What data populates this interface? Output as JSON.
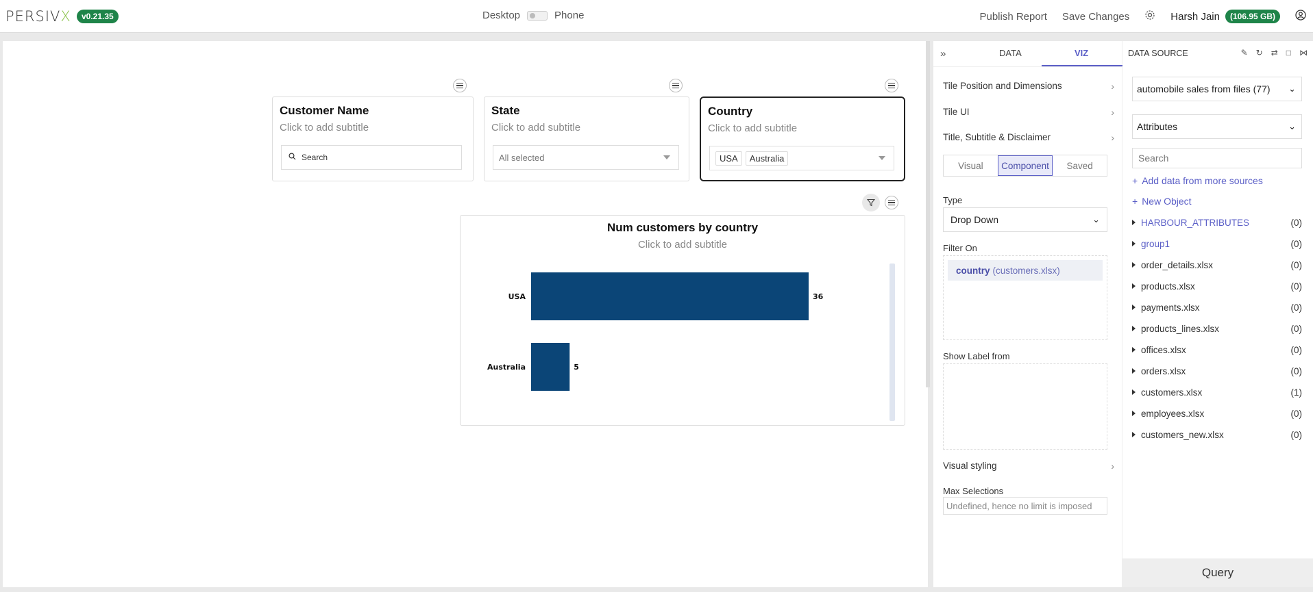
{
  "app": {
    "logo_main": "PERSIV",
    "logo_x": "X",
    "version": "v0.21.35"
  },
  "device": {
    "desktop": "Desktop",
    "phone": "Phone"
  },
  "header": {
    "publish": "Publish Report",
    "save": "Save Changes",
    "user": "Harsh Jain",
    "storage": "(106.95 GB)"
  },
  "tiles": {
    "customer_name": {
      "title": "Customer Name",
      "subtitle": "Click to add subtitle",
      "search_placeholder": "Search"
    },
    "state": {
      "title": "State",
      "subtitle": "Click to add subtitle",
      "value": "All selected"
    },
    "country": {
      "title": "Country",
      "subtitle": "Click to add subtitle",
      "chips": [
        "USA",
        "Australia"
      ]
    }
  },
  "chart_data": {
    "type": "bar",
    "orientation": "horizontal",
    "title": "Num customers by country",
    "subtitle": "Click to add subtitle",
    "categories": [
      "USA",
      "Australia"
    ],
    "values": [
      36,
      5
    ],
    "color": "#0b4577",
    "grid": false
  },
  "viz_panel": {
    "tabs": {
      "data": "DATA",
      "viz": "VIZ"
    },
    "sections": [
      "Tile Position and Dimensions",
      "Tile UI",
      "Title, Subtitle & Disclaimer"
    ],
    "segments": {
      "visual": "Visual",
      "component": "Component",
      "saved": "Saved"
    },
    "type_label": "Type",
    "type_value": "Drop Down",
    "filter_on_label": "Filter On",
    "filter_field": "country",
    "filter_source": "(customers.xlsx)",
    "show_label_from": "Show Label from",
    "visual_styling": "Visual styling",
    "max_selections_label": "Max Selections",
    "max_selections_placeholder": "Undefined, hence no limit is imposed"
  },
  "data_source": {
    "title": "DATA SOURCE",
    "source_select": "automobile sales from files (77)",
    "attr_select": "Attributes",
    "search_placeholder": "Search",
    "add_more": "Add data from more sources",
    "new_object": "New Object",
    "items": [
      {
        "name": "HARBOUR_ATTRIBUTES",
        "count": "(0)"
      },
      {
        "name": "group1",
        "count": "(0)"
      },
      {
        "name": "order_details.xlsx",
        "count": "(0)"
      },
      {
        "name": "products.xlsx",
        "count": "(0)"
      },
      {
        "name": "payments.xlsx",
        "count": "(0)"
      },
      {
        "name": "products_lines.xlsx",
        "count": "(0)"
      },
      {
        "name": "offices.xlsx",
        "count": "(0)"
      },
      {
        "name": "orders.xlsx",
        "count": "(0)"
      },
      {
        "name": "customers.xlsx",
        "count": "(1)"
      },
      {
        "name": "employees.xlsx",
        "count": "(0)"
      },
      {
        "name": "customers_new.xlsx",
        "count": "(0)"
      }
    ],
    "query": "Query"
  }
}
